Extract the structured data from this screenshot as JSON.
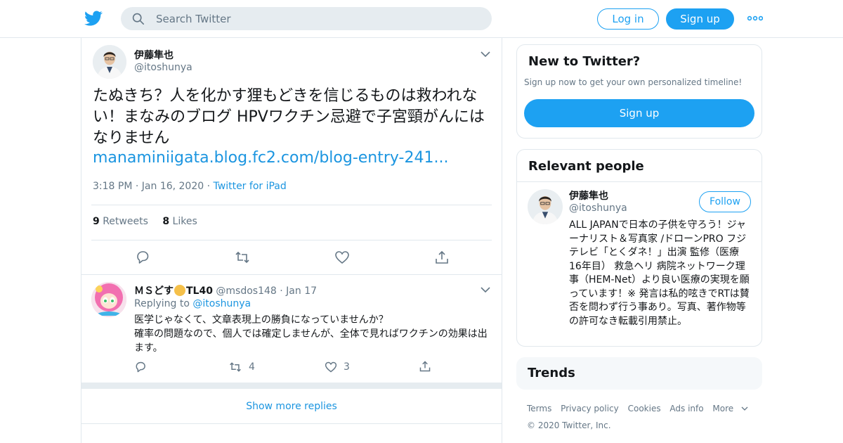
{
  "header": {
    "search_placeholder": "Search Twitter",
    "login_label": "Log in",
    "signup_label": "Sign up",
    "brand_color": "#1da1f2",
    "icons": [
      "twitter-bird-icon",
      "search-icon",
      "more-dots-icon"
    ]
  },
  "tweet": {
    "author_name": "伊藤隼也",
    "author_handle": "@itoshunya",
    "text": "たぬきち？人を化かす狸もどきを信じるものは救われない！まなみのブログ HPVワクチン忌避で子宮頸がんにはなりません",
    "link": "manaminiigata.blog.fc2.com/blog-entry-241...",
    "time": "3:18 PM",
    "date": "Jan 16, 2020",
    "source": "Twitter for iPad",
    "retweets_count": "9",
    "retweets_label": "Retweets",
    "likes_count": "8",
    "likes_label": "Likes"
  },
  "reply": {
    "name_part1": "ＭＳどす",
    "name_part2": "TL40",
    "handle": "@msdos148",
    "date": "Jan 17",
    "replying_prefix": "Replying to",
    "replying_to": "@itoshunya",
    "text": "医学じゃなくて、文章表現上の勝負になっていませんか？\n確率の問題なので、個人では確定しませんが、全体で見ればワクチンの効果は出ます。",
    "retweet_count": "4",
    "like_count": "3"
  },
  "show_more_label": "Show more replies",
  "sidebar": {
    "new_title": "New to Twitter?",
    "new_subtitle": "Sign up now to get your own personalized timeline!",
    "new_signup_label": "Sign up",
    "relevant_title": "Relevant people",
    "person_name": "伊藤隼也",
    "person_handle": "@itoshunya",
    "follow_label": "Follow",
    "person_bio": "ALL JAPANで日本の子供を守ろう！ジャーナリスト＆写真家 /ドローンPRO フジテレビ「とくダネ！」出演 監修（医療 16年目） 救急ヘリ 病院ネットワーク理事（HEM-Net）より良い医療の実現を願っています！※ 発言は私的呟きでRTは賛否を問わず行う事あり。写真、著作物等の許可なき転載引用禁止。",
    "trends_title": "Trends"
  },
  "footer": {
    "links": [
      "Terms",
      "Privacy policy",
      "Cookies",
      "Ads info",
      "More"
    ],
    "copyright": "© 2020 Twitter, Inc."
  }
}
